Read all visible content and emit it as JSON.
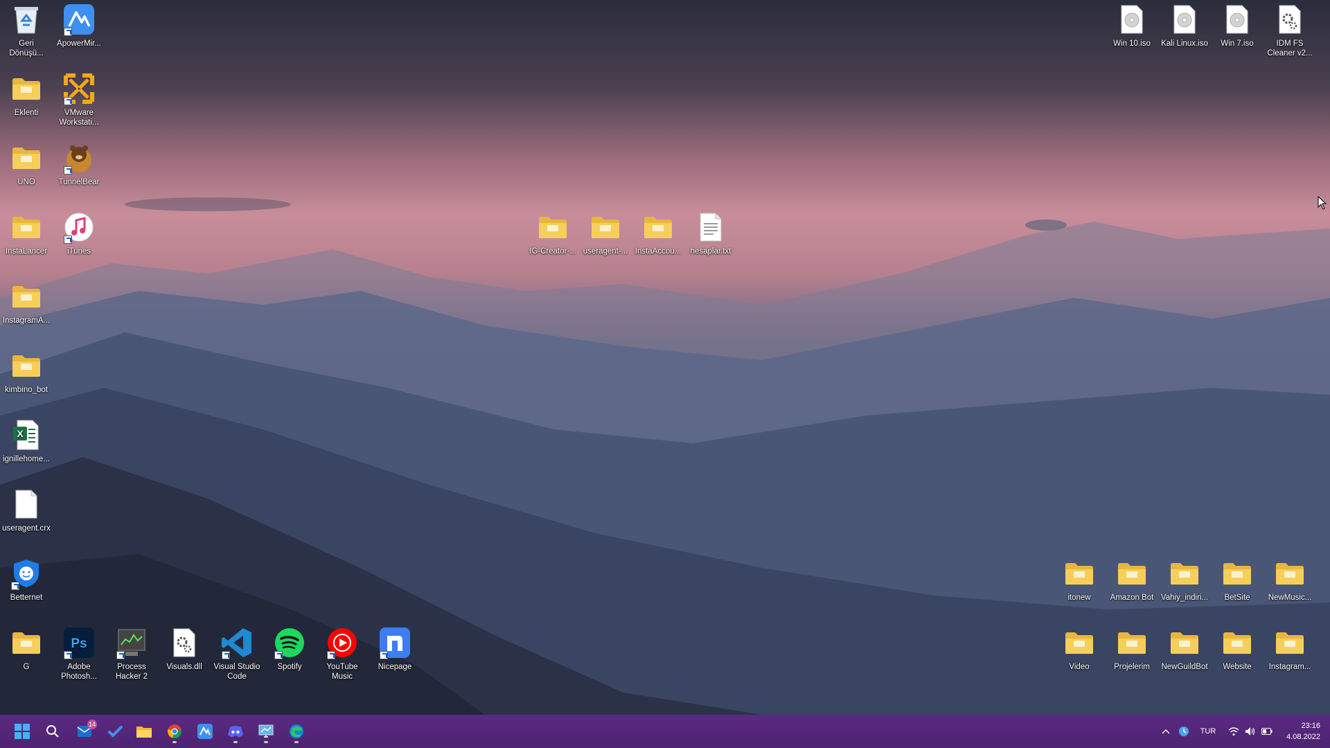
{
  "desktop": {
    "icons_left": [
      {
        "label": "Geri Dönüşü...",
        "icon": "recycle-bin-icon"
      },
      {
        "label": "ApowerMir...",
        "icon": "apowermirror-icon"
      },
      {
        "label": "Eklenti",
        "icon": "folder-icon"
      },
      {
        "label": "VMware Workstati...",
        "icon": "vmware-icon"
      },
      {
        "label": "UNO",
        "icon": "folder-icon"
      },
      {
        "label": "TunnelBear",
        "icon": "tunnelbear-icon"
      },
      {
        "label": "InstaLancer",
        "icon": "folder-icon"
      },
      {
        "label": "iTunes",
        "icon": "itunes-icon"
      },
      {
        "label": "InstagramA...",
        "icon": "folder-icon"
      },
      {
        "label": "kimbino_bot",
        "icon": "folder-icon"
      },
      {
        "label": "ignillehome...",
        "icon": "excel-file-icon"
      },
      {
        "label": "useragent.crx",
        "icon": "file-icon"
      },
      {
        "label": "Betternet",
        "icon": "betternet-icon"
      },
      {
        "label": "G",
        "icon": "folder-icon"
      },
      {
        "label": "Adobe Photosh...",
        "icon": "photoshop-icon"
      },
      {
        "label": "Process Hacker 2",
        "icon": "process-hacker-icon"
      },
      {
        "label": "Visuals.dll",
        "icon": "dll-file-icon"
      },
      {
        "label": "Visual Studio Code",
        "icon": "vscode-icon"
      },
      {
        "label": "Spotify",
        "icon": "spotify-icon"
      },
      {
        "label": "YouTube Music",
        "icon": "youtube-music-icon"
      },
      {
        "label": "Nicepage",
        "icon": "nicepage-icon"
      }
    ],
    "icons_center": [
      {
        "label": "IG-Creator-...",
        "icon": "folder-icon"
      },
      {
        "label": "useragent-...",
        "icon": "folder-icon"
      },
      {
        "label": "InstaAccou...",
        "icon": "folder-icon"
      },
      {
        "label": "hesaplar.txt",
        "icon": "text-file-icon"
      }
    ],
    "icons_top_right": [
      {
        "label": "Win 10.iso",
        "icon": "disc-image-icon"
      },
      {
        "label": "Kali Linux.iso",
        "icon": "disc-image-icon"
      },
      {
        "label": "Win 7.iso",
        "icon": "disc-image-icon"
      },
      {
        "label": "IDM FS Cleaner v2...",
        "icon": "settings-file-icon"
      }
    ],
    "icons_bottom_right": [
      {
        "label": "itonew",
        "icon": "folder-icon"
      },
      {
        "label": "Amazon Bot",
        "icon": "folder-icon"
      },
      {
        "label": "Vahiy_indiri...",
        "icon": "folder-icon"
      },
      {
        "label": "BetSite",
        "icon": "folder-icon"
      },
      {
        "label": "NewMusic...",
        "icon": "folder-icon"
      },
      {
        "label": "Video",
        "icon": "folder-icon"
      },
      {
        "label": "Projelerim",
        "icon": "folder-icon"
      },
      {
        "label": "NewGuildBot",
        "icon": "folder-icon"
      },
      {
        "label": "Website",
        "icon": "folder-icon"
      },
      {
        "label": "Instagram...",
        "icon": "folder-icon"
      }
    ]
  },
  "taskbar": {
    "apps": [
      {
        "name": "start-icon"
      },
      {
        "name": "search-icon"
      },
      {
        "name": "mail-icon",
        "badge": "14"
      },
      {
        "name": "todo-icon"
      },
      {
        "name": "file-explorer-icon"
      },
      {
        "name": "chrome-icon"
      },
      {
        "name": "apowermirror-icon"
      },
      {
        "name": "discord-icon"
      },
      {
        "name": "remote-desktop-icon"
      },
      {
        "name": "edge-icon"
      }
    ],
    "tray": {
      "language": "TUR",
      "time": "23:16",
      "date": "4.08.2022"
    }
  },
  "colors": {
    "taskbar": "#4d2371",
    "folder": "#f3c64c",
    "sky_top": "#2b2e3d",
    "sky_pink": "#c98a98",
    "mountains": "#3d4c6e"
  }
}
